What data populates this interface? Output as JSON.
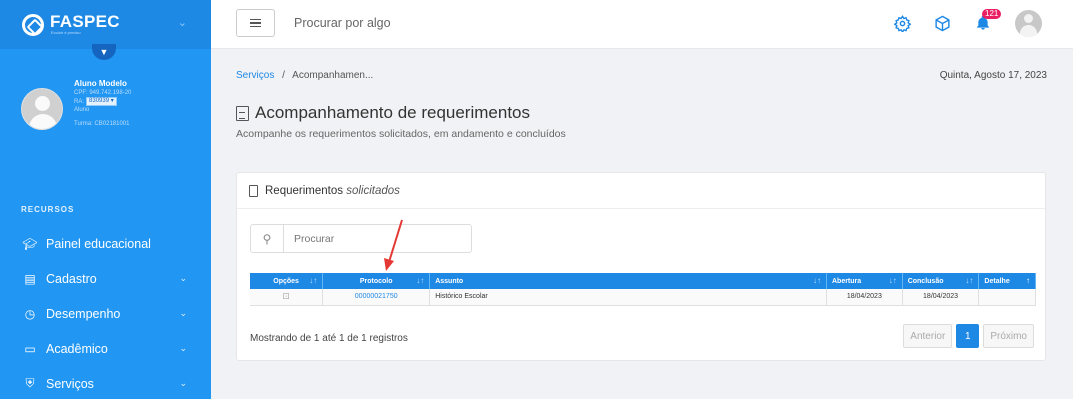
{
  "app": {
    "brand": "FASPEC",
    "brand_sub": "Evoluir é preciso"
  },
  "profile": {
    "name": "Aluno Modelo",
    "cpf": "CPF: 949.742.198-20",
    "ra_label": "RA:",
    "ra_value": "830939",
    "role": "Aluno",
    "turma": "Turma: CB02181001"
  },
  "sidebar": {
    "section": "RECURSOS",
    "items": [
      {
        "label": "Painel educacional"
      },
      {
        "label": "Cadastro"
      },
      {
        "label": "Desempenho"
      },
      {
        "label": "Acadêmico"
      },
      {
        "label": "Serviços"
      }
    ]
  },
  "topbar": {
    "search_placeholder": "Procurar por algo",
    "notifications": "121"
  },
  "breadcrumb": {
    "root": "Serviços",
    "sep": "/",
    "current": "Acompanhamen..."
  },
  "date": "Quinta, Agosto 17, 2023",
  "page": {
    "title": "Acompanhamento de requerimentos",
    "subtitle": "Acompanhe os requerimentos solicitados, em andamento e concluídos"
  },
  "card": {
    "title": "Requerimentos",
    "title_em": "solicitados",
    "search_placeholder": "Procurar",
    "columns": [
      "Opções",
      "Protocolo",
      "Assunto",
      "Abertura",
      "Conclusão",
      "Detalhe"
    ],
    "rows": [
      {
        "protocolo": "00000021750",
        "assunto": "Histórico Escolar",
        "abertura": "18/04/2023",
        "conclusao": "18/04/2023"
      }
    ],
    "info": "Mostrando de 1 até 1 de 1 registros",
    "pager": {
      "prev": "Anterior",
      "page": "1",
      "next": "Próximo"
    }
  },
  "colors": {
    "primary": "#1e88e5",
    "sidebar": "#2196f3",
    "badge": "#e91e63",
    "arrow": "#e53935"
  }
}
